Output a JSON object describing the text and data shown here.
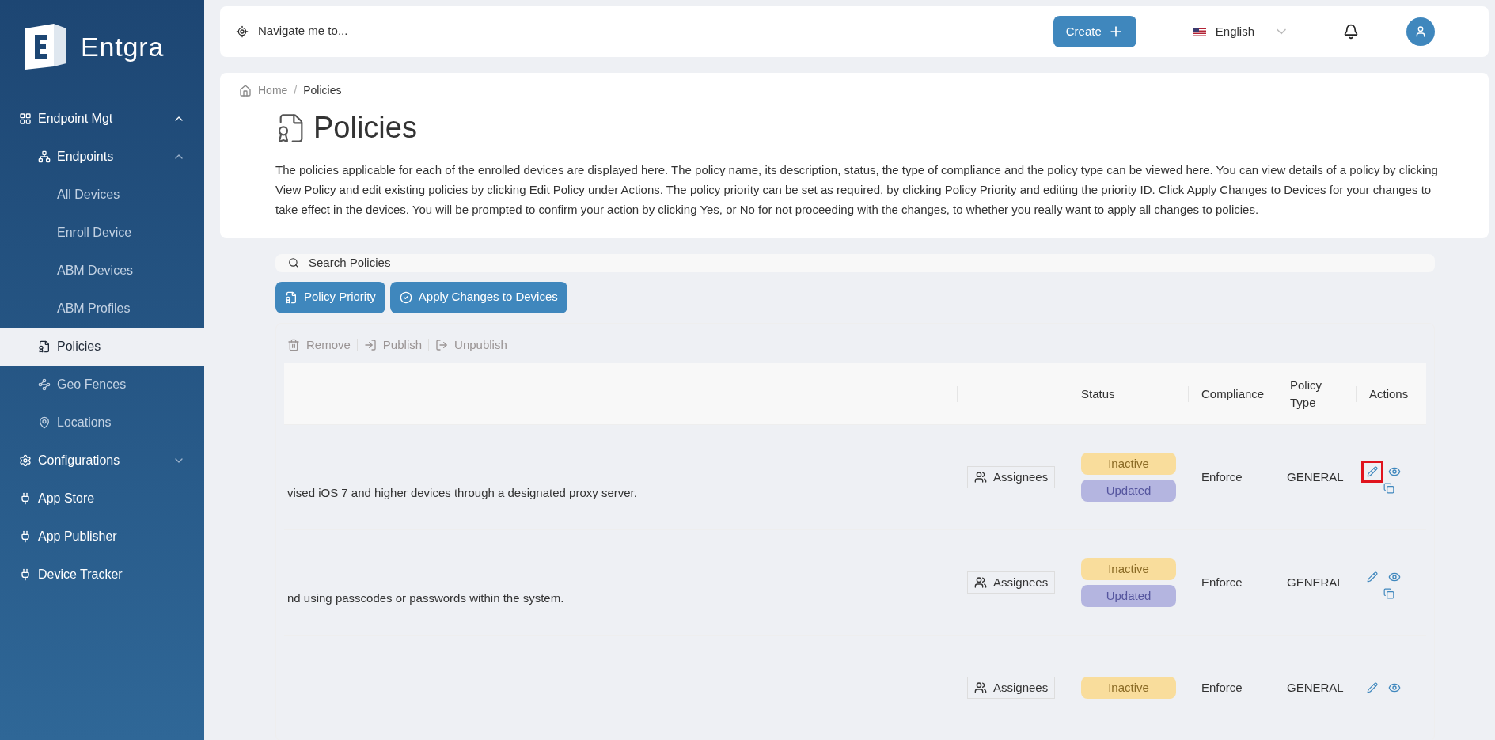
{
  "sidebar": {
    "logo_text": "Entgra",
    "items": [
      {
        "label": "Endpoint Mgt",
        "expanded": true,
        "selected": false,
        "children": [
          {
            "label": "Endpoints",
            "expanded": true,
            "selected": false,
            "children": [
              {
                "label": "All Devices",
                "selected": false
              },
              {
                "label": "Enroll Device",
                "selected": false
              },
              {
                "label": "ABM Devices",
                "selected": false
              },
              {
                "label": "ABM Profiles",
                "selected": false
              }
            ]
          },
          {
            "label": "Policies",
            "selected": true
          },
          {
            "label": "Geo Fences",
            "selected": false
          },
          {
            "label": "Locations",
            "selected": false
          }
        ]
      },
      {
        "label": "Configurations",
        "expanded": false,
        "selected": false
      },
      {
        "label": "App Store",
        "selected": false
      },
      {
        "label": "App Publisher",
        "selected": false
      },
      {
        "label": "Device Tracker",
        "selected": false
      }
    ]
  },
  "topbar": {
    "navigate_placeholder": "Navigate me to...",
    "create_button": "Create",
    "language": "English"
  },
  "breadcrumb": {
    "items": [
      "Home",
      "Policies"
    ],
    "separator": "/"
  },
  "page": {
    "title": "Policies",
    "description": "The policies applicable for each of the enrolled devices are displayed here. The policy name, its description, status, the type of compliance and the policy type can be viewed here. You can view details of a policy by clicking View Policy and edit existing policies by clicking Edit Policy under Actions. The policy priority can be set as required, by clicking Policy Priority and editing the priority ID. Click Apply Changes to Devices for your changes to take effect in the devices. You will be prompted to confirm your action by clicking Yes, or No for not proceeding with the changes, to whether you really want to apply all changes to policies."
  },
  "search": {
    "placeholder": "Search Policies"
  },
  "buttons": [
    "Policy Priority",
    "Apply Changes to Devices"
  ],
  "toolbar": [
    {
      "label": "Remove",
      "disabled": true
    },
    {
      "label": "Publish",
      "disabled": true
    },
    {
      "label": "Unpublish",
      "disabled": true
    }
  ],
  "table": {
    "columns": [
      "Status",
      "Compliance",
      "Policy Type",
      "Actions"
    ],
    "rows": [
      {
        "description": "vised iOS 7 and higher devices through a designated proxy server.",
        "assignees": "Assignees",
        "statuses": [
          {
            "label": "Inactive",
            "kind": "state"
          },
          {
            "label": "Updated",
            "kind": "update"
          }
        ],
        "compliance": "Enforce",
        "policy_type": "GENERAL",
        "edit_highlighted": true
      },
      {
        "description": "nd using passcodes or passwords within the system.",
        "assignees": "Assignees",
        "statuses": [
          {
            "label": "Inactive",
            "kind": "state"
          },
          {
            "label": "Updated",
            "kind": "update"
          }
        ],
        "compliance": "Enforce",
        "policy_type": "GENERAL",
        "edit_highlighted": false
      },
      {
        "assignees": "Assignees",
        "statuses": [
          {
            "label": "Inactive",
            "kind": "state"
          }
        ],
        "compliance": "Enforce",
        "policy_type": "GENERAL",
        "edit_highlighted": false
      }
    ]
  }
}
